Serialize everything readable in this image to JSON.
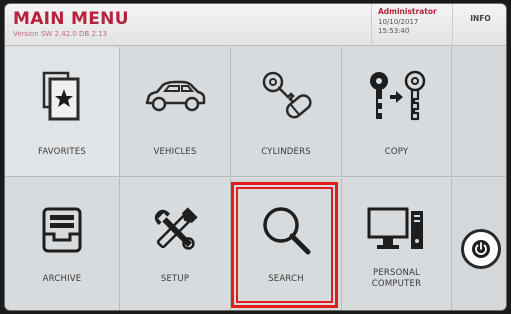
{
  "header": {
    "title": "MAIN MENU",
    "version": "Version SW 2.42.0 DB 2.13",
    "user": "Administrator",
    "date": "10/10/2017",
    "time": "15:53:40",
    "info_label": "INFO"
  },
  "menu": {
    "favorites": "FAVORITES",
    "vehicles": "VEHICLES",
    "cylinders": "CYLINDERS",
    "copy": "COPY",
    "archive": "ARCHIVE",
    "setup": "SETUP",
    "search": "SEARCH",
    "personal_computer_line1": "PERSONAL",
    "personal_computer_line2": "COMPUTER"
  },
  "icons": {
    "favorites": "star-card-icon",
    "vehicles": "car-icon",
    "cylinders": "key-cylinder-icon",
    "copy": "key-copy-icon",
    "archive": "tray-icon",
    "setup": "tools-icon",
    "search": "magnifier-icon",
    "personal_computer": "desktop-computer-icon",
    "power": "power-icon"
  },
  "colors": {
    "brand_red": "#b7233a",
    "highlight_red": "#e41b1b",
    "tile_bg": "#d7dbde"
  }
}
